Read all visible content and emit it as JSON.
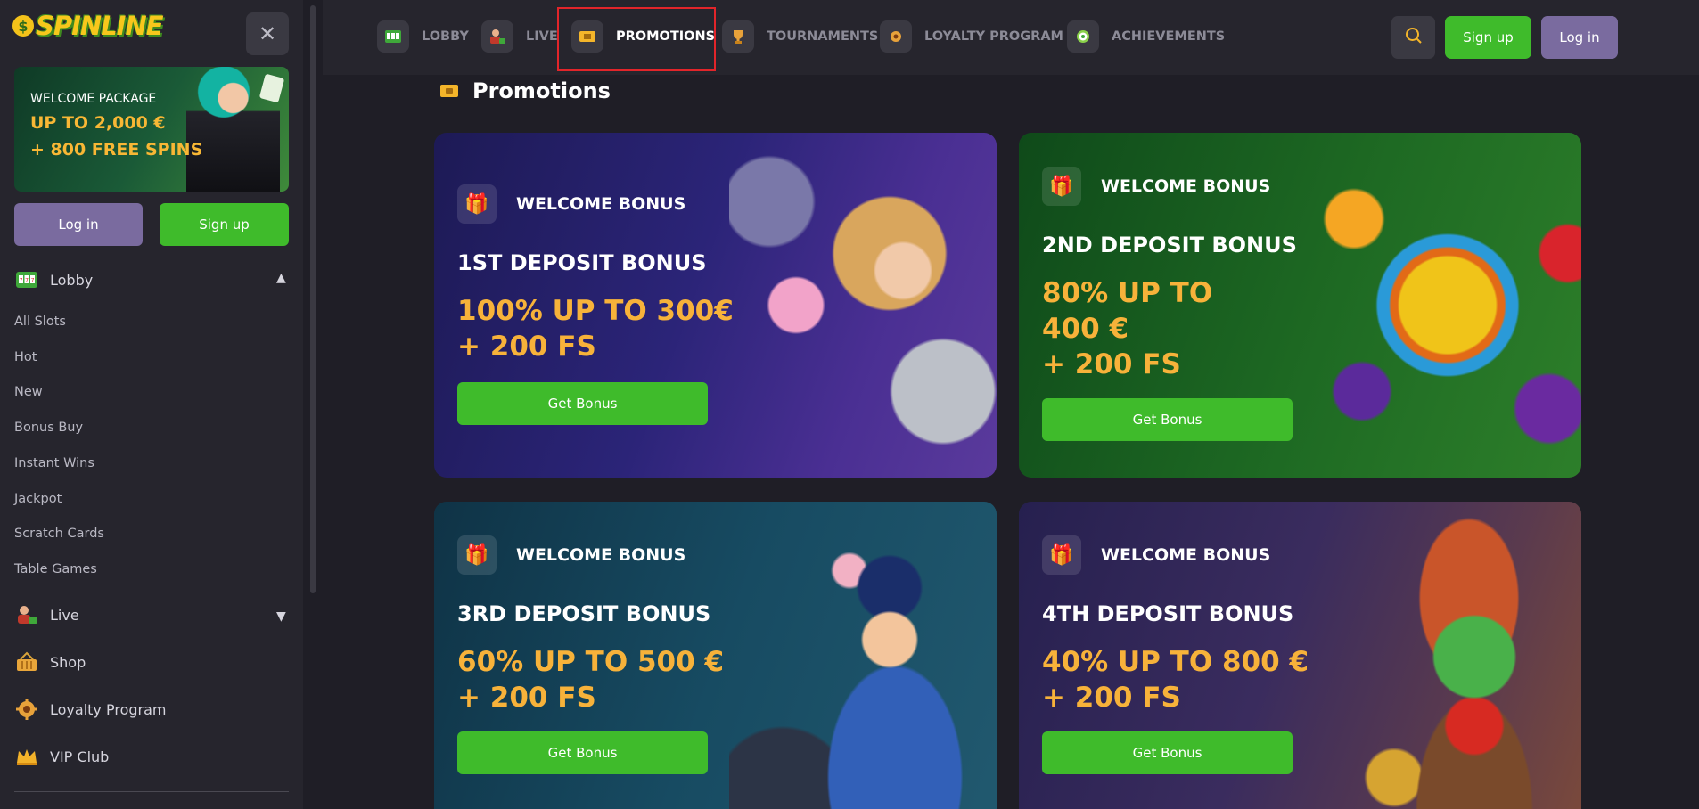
{
  "brand": {
    "logo_text": "SPINLINE"
  },
  "sidebar": {
    "close_glyph": "✕",
    "promo": {
      "line1": "WELCOME PACKAGE",
      "line2": "UP TO 2,000 €",
      "line3": "+ 800 FREE SPINS"
    },
    "login_label": "Log in",
    "signup_label": "Sign up",
    "lobby": {
      "label": "Lobby",
      "icon": "slot-machine-icon",
      "expanded": true,
      "items": [
        "All Slots",
        "Hot",
        "New",
        "Bonus Buy",
        "Instant Wins",
        "Jackpot",
        "Scratch Cards",
        "Table Games"
      ]
    },
    "live": {
      "label": "Live",
      "icon": "live-dealer-icon"
    },
    "shop": {
      "label": "Shop",
      "icon": "basket-icon"
    },
    "loyalty": {
      "label": "Loyalty Program",
      "icon": "gear-icon"
    },
    "vip": {
      "label": "VIP Club",
      "icon": "crown-icon"
    }
  },
  "topnav": {
    "tabs": [
      {
        "label": "LOBBY",
        "icon": "slot-machine-icon"
      },
      {
        "label": "LIVE",
        "icon": "live-dealer-icon"
      },
      {
        "label": "PROMOTIONS",
        "icon": "ticket-icon",
        "active": true
      },
      {
        "label": "TOURNAMENTS",
        "icon": "trophy-icon"
      },
      {
        "label": "LOYALTY PROGRAM",
        "icon": "gear-icon"
      },
      {
        "label": "ACHIEVEMENTS",
        "icon": "target-icon"
      }
    ],
    "signup_label": "Sign up",
    "login_label": "Log in"
  },
  "main": {
    "title": "Promotions",
    "cards": [
      {
        "badge": "WELCOME BONUS",
        "title": "1ST DEPOSIT BONUS",
        "offer_lines": [
          "100% UP TO 300€",
          "+ 200 FS"
        ],
        "button": "Get Bonus"
      },
      {
        "badge": "WELCOME BONUS",
        "title": "2ND DEPOSIT BONUS",
        "offer_lines": [
          "80% UP TO",
          "400 €",
          "+ 200 FS"
        ],
        "button": "Get Bonus"
      },
      {
        "badge": "WELCOME BONUS",
        "title": "3RD DEPOSIT BONUS",
        "offer_lines": [
          "60% UP TO 500 €",
          "+ 200 FS"
        ],
        "button": "Get Bonus"
      },
      {
        "badge": "WELCOME BONUS",
        "title": "4TH DEPOSIT BONUS",
        "offer_lines": [
          "40% UP TO 800 €",
          "+ 200 FS"
        ],
        "button": "Get Bonus"
      }
    ]
  },
  "colors": {
    "accent_green": "#3fbb2b",
    "accent_purple": "#7a6b9f",
    "offer_gold": "#f7b23a",
    "active_highlight": "#e2252a"
  }
}
